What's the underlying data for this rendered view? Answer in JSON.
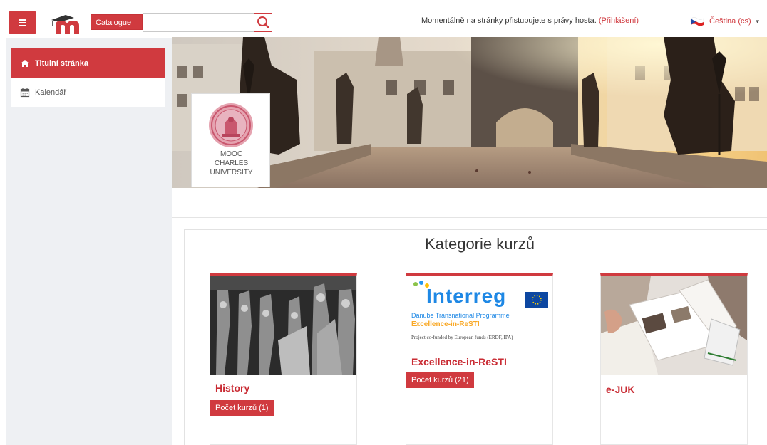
{
  "navbar": {
    "menu_icon": "hamburger-icon",
    "logo_icon": "moodle-logo-icon",
    "catalogue_label": "Catalogue",
    "search_placeholder": "",
    "search_icon": "search-icon",
    "guest_text": "Momentálně na stránky přistupujete s právy hosta.",
    "login_link": "(Přihlášení)",
    "language": "Čeština (cs)",
    "language_flag": "czech-flag-icon"
  },
  "sidebar": {
    "items": [
      {
        "label": "Titulní stránka",
        "icon": "home-icon",
        "active": true
      },
      {
        "label": "Kalendář",
        "icon": "calendar-icon",
        "active": false
      }
    ]
  },
  "banner": {
    "logo_lines": [
      "MOOC",
      "CHARLES",
      "UNIVERSITY"
    ]
  },
  "categories": {
    "heading": "Kategorie kurzů",
    "items": [
      {
        "title": "History",
        "badge": "Počet kurzů (1)"
      },
      {
        "title": "Excellence-in-ReSTI",
        "badge": "Počet kurzů (21)",
        "image_text": {
          "brand": "Interreg",
          "programme": "Danube Transnational Programme",
          "project": "Excellence-in-ReSTI",
          "funding": "Project co-funded by European funds (ERDF, IPA)"
        }
      },
      {
        "title": "e-JUK",
        "badge": ""
      }
    ]
  },
  "colors": {
    "accent": "#d03a3f",
    "sidebar_bg": "#eef0f3"
  }
}
